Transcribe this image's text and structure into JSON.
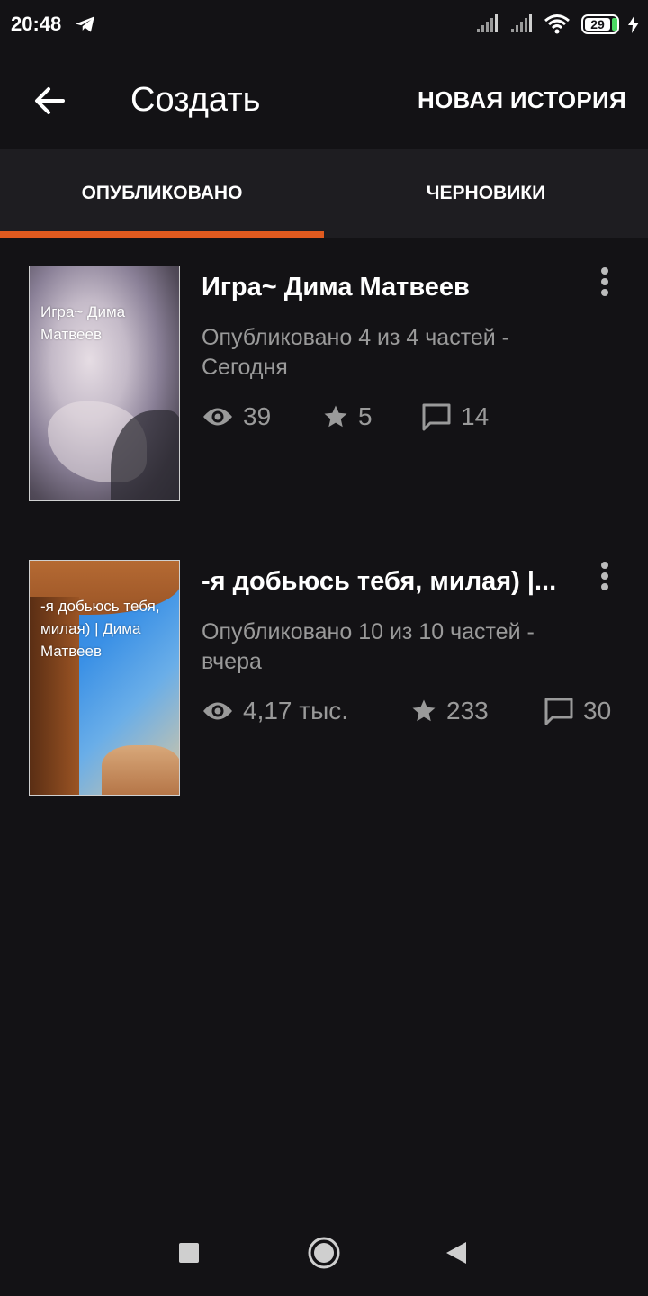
{
  "status_bar": {
    "time": "20:48",
    "battery_level": "29",
    "icons": [
      "telegram-icon",
      "signal-icon",
      "signal-icon",
      "wifi-icon",
      "battery-icon",
      "charging-icon"
    ]
  },
  "app_bar": {
    "title": "Создать",
    "action_label": "НОВАЯ ИСТОРИЯ",
    "back_icon": "arrow-left-icon"
  },
  "tabs": [
    {
      "label": "ОПУБЛИКОВАНО",
      "selected": true
    },
    {
      "label": "ЧЕРНОВИКИ",
      "selected": false
    }
  ],
  "accent_color": "#e05a1f",
  "stories": [
    {
      "cover_text": "Игра~ Дима Матвеев",
      "title": "Игра~ Дима Матвеев",
      "meta": "Опубликовано 4 из 4 частей - Сегодня",
      "views": "39",
      "votes": "5",
      "comments": "14"
    },
    {
      "cover_text": "-я добьюсь тебя, милая) | Дима Матвеев",
      "title": "-я добьюсь тебя, милая) |...",
      "meta": "Опубликовано 10 из 10 частей - вчера",
      "views": "4,17 тыс.",
      "votes": "233",
      "comments": "30"
    }
  ],
  "nav_bar": {
    "icons": [
      "recents-icon",
      "home-icon",
      "back-icon"
    ]
  }
}
